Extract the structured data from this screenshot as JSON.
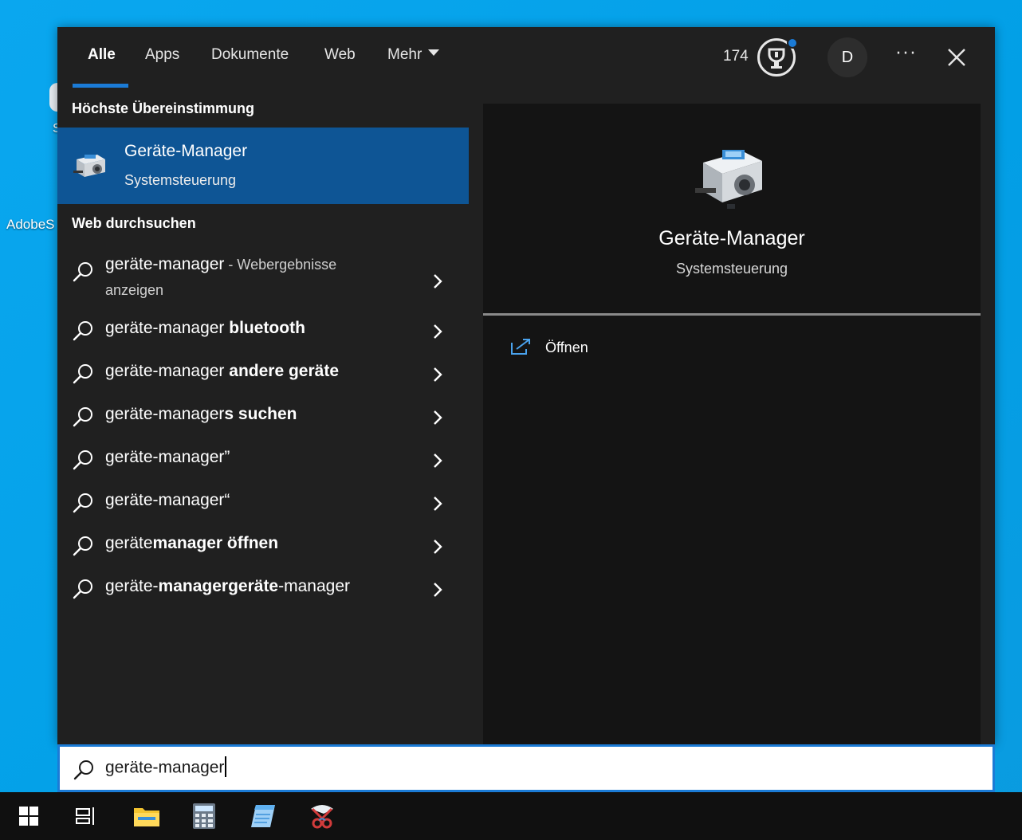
{
  "desktop": {
    "icon_label_1": "AdobeS",
    "icon_label_2": "S"
  },
  "tabs": [
    {
      "label": "Alle",
      "active": true
    },
    {
      "label": "Apps",
      "active": false
    },
    {
      "label": "Dokumente",
      "active": false
    },
    {
      "label": "Web",
      "active": false
    },
    {
      "label": "Mehr",
      "active": false
    }
  ],
  "header": {
    "points": "174",
    "rewards_icon": "trophy-icon",
    "avatar_initial": "D",
    "more_label": "···",
    "close_icon": "close-icon"
  },
  "best_match": {
    "section_title": "Höchste Übereinstimmung",
    "title": "Geräte-Manager",
    "subtitle": "Systemsteuerung",
    "icon": "device-manager-icon"
  },
  "web_search": {
    "section_title": "Web durchsuchen",
    "first": {
      "query": "geräte-manager",
      "suffix": " - Webergebnisse anzeigen"
    },
    "items": [
      {
        "normal": "geräte-manager ",
        "bold": "bluetooth",
        "tail": ""
      },
      {
        "normal": "geräte-manager ",
        "bold": "andere geräte",
        "tail": ""
      },
      {
        "normal": "geräte-manager",
        "bold": "s suchen",
        "tail": ""
      },
      {
        "normal": "geräte-manager”",
        "bold": "",
        "tail": ""
      },
      {
        "normal": "geräte-manager“",
        "bold": "",
        "tail": ""
      },
      {
        "normal": "geräte",
        "bold": "manager öffnen",
        "tail": ""
      },
      {
        "normal": "geräte-",
        "bold": "managergeräte",
        "tail": "-manager"
      }
    ]
  },
  "preview": {
    "title": "Geräte-Manager",
    "subtitle": "Systemsteuerung",
    "action_label": "Öffnen",
    "action_icon": "open-external-icon"
  },
  "search": {
    "value": "geräte-manager",
    "icon": "search-icon"
  },
  "taskbar": {
    "items": [
      "windows-start-icon",
      "task-view-icon",
      "file-explorer-icon",
      "calculator-icon",
      "notepad-icon",
      "snipping-tool-icon"
    ]
  },
  "colors": {
    "accent": "#1b7bd6",
    "selected_bg": "#0e5595",
    "panel_bg": "#202020",
    "preview_bg": "#141414",
    "desktop_bg": "#00a2e8"
  }
}
